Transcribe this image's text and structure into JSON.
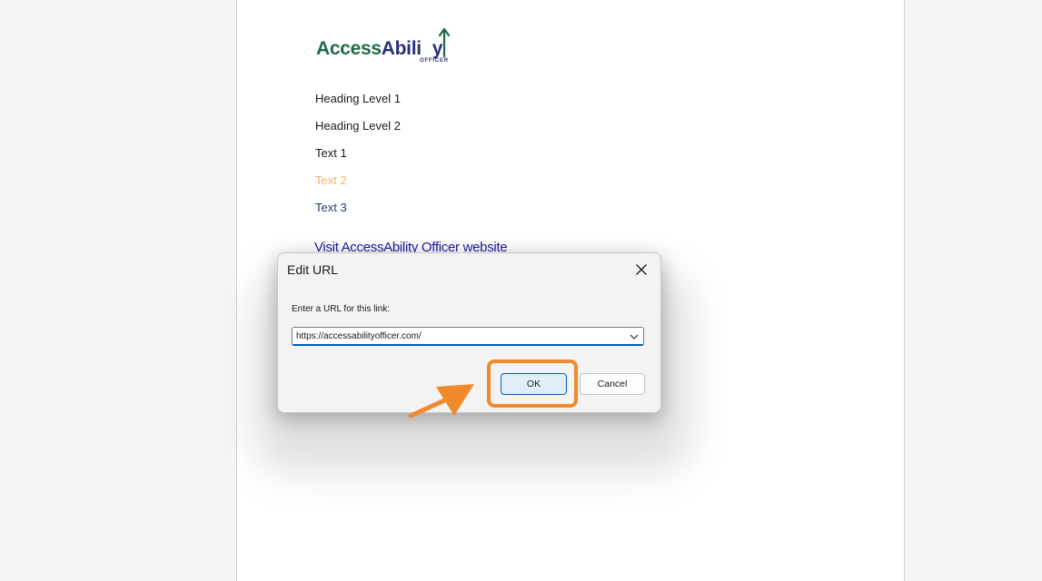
{
  "document": {
    "logo": {
      "name_part1": "Access",
      "name_part2": "Abili",
      "name_part3": "y",
      "subtitle": "OFFICER",
      "colors": {
        "green": "#1f6b45",
        "navy": "#2a2f7a"
      }
    },
    "lines": [
      {
        "text": "Heading Level 1",
        "color": "#1a1a1a"
      },
      {
        "text": "Heading Level 2",
        "color": "#1a1a1a"
      },
      {
        "text": "Text 1",
        "color": "#1a1a1a"
      },
      {
        "text": "Text 2",
        "color": "#f5b46a"
      },
      {
        "text": "Text 3",
        "color": "#1f3a6e"
      }
    ],
    "link": {
      "text": "Visit AccessAbility Officer website",
      "color": "#1a1aa6"
    }
  },
  "dialog": {
    "title": "Edit URL",
    "prompt": "Enter a URL for this link:",
    "url_value": "https://accessabilityofficer.com/",
    "ok_label": "OK",
    "cancel_label": "Cancel",
    "close_icon": "close-icon",
    "dropdown_icon": "chevron-down-icon"
  },
  "annotation": {
    "highlight_color": "#f08a2b",
    "arrow_icon": "pointer-arrow-icon"
  }
}
